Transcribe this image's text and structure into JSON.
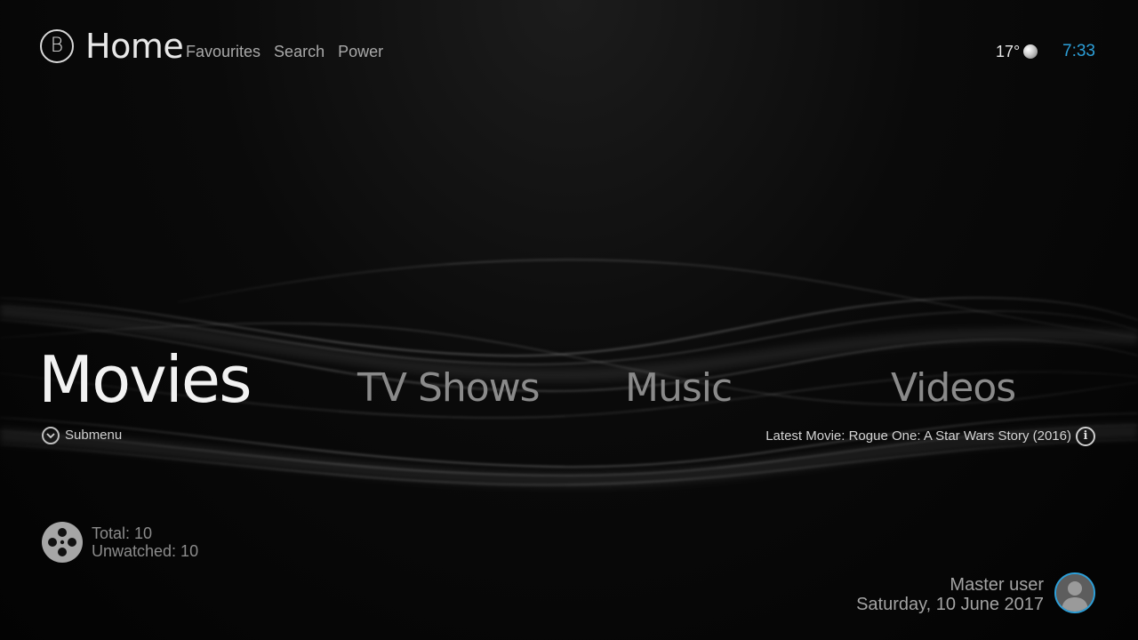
{
  "header": {
    "logo_letter": "B",
    "title": "Home",
    "nav": [
      "Favourites",
      "Search",
      "Power"
    ],
    "temperature": "17°",
    "weather_icon": "moon-icon",
    "time": "7:33"
  },
  "main_menu": {
    "items": [
      "Movies",
      "TV Shows",
      "Music",
      "Videos"
    ],
    "selected": "Movies"
  },
  "submenu_label": "Submenu",
  "latest": {
    "text": "Latest Movie: Rogue One: A Star Wars Story (2016)",
    "icon": "info-icon"
  },
  "stats": {
    "icon": "film-reel-icon",
    "total": "Total: 10",
    "unwatched": "Unwatched: 10"
  },
  "user": {
    "name": "Master user",
    "date": "Saturday, 10 June 2017",
    "avatar_icon": "user-avatar-icon"
  },
  "colors": {
    "accent": "#2d9fd8",
    "background": "#030303"
  }
}
